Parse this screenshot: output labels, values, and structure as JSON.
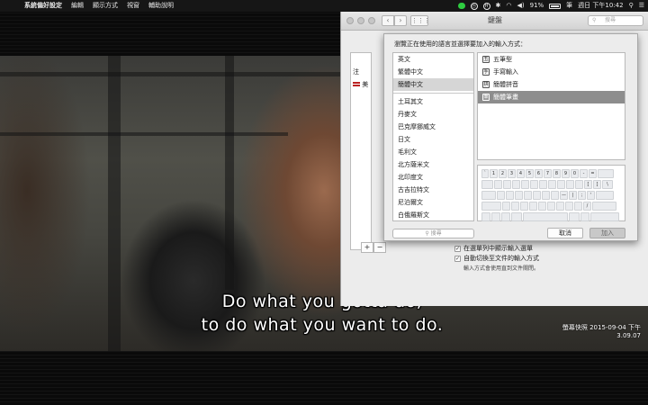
{
  "menubar": {
    "app_name": "系統偏好設定",
    "items": [
      "編輯",
      "顯示方式",
      "視窗",
      "輔助說明"
    ],
    "battery_percent": "91%",
    "clock": "週日 下午10:42"
  },
  "video": {
    "subtitle_line1": "Do what you gotta do,",
    "subtitle_line2": "to do what you want to do.",
    "stamp_line1": "螢幕快照 2015-09-04 下午",
    "stamp_line2": "3.09.07"
  },
  "prefs": {
    "title": "鍵盤",
    "search_placeholder": "搜尋",
    "sources": [
      "注",
      "美"
    ],
    "plus": "+",
    "minus": "−",
    "check1": "在選單列中顯示輸入選單",
    "check2": "自動切換至文件的輸入方式",
    "note": "輸入方式會使用直到文件關閉。"
  },
  "sheet": {
    "instruction": "瀏覽正在使用的語言並選擇要加入的輸入方式：",
    "languages_top": [
      "英文",
      "繁體中文",
      "簡體中文"
    ],
    "languages_rest": [
      "土耳其文",
      "丹麥文",
      "巴克摩挪威文",
      "日文",
      "毛利文",
      "北方薩米文",
      "北印度文",
      "古吉拉特文",
      "尼泊爾文",
      "白俄羅斯文"
    ],
    "selected_language": "簡體中文",
    "methods": [
      {
        "icon": "五",
        "label": "五筆型"
      },
      {
        "icon": "手",
        "label": "手寫輸入"
      },
      {
        "icon": "拼",
        "label": "簡體拼音"
      },
      {
        "icon": "筆",
        "label": "簡體筆畫"
      }
    ],
    "selected_method": "簡體筆畫",
    "keyboard_rows": [
      [
        "`",
        "1",
        "2",
        "3",
        "4",
        "5",
        "6",
        "7",
        "8",
        "9",
        "0",
        "-",
        "="
      ],
      [
        "",
        "",
        "",
        "",
        "",
        "",
        "",
        "",
        "",
        "",
        "[",
        "]",
        "\\"
      ],
      [
        "",
        "",
        "",
        "",
        "",
        "",
        "",
        "—",
        "|",
        ";",
        "'"
      ],
      [
        "",
        "",
        "",
        "",
        "",
        "",
        "",
        "",
        "",
        "/"
      ]
    ],
    "search_placeholder": "搜尋",
    "cancel_label": "取消",
    "add_label": "加入"
  }
}
